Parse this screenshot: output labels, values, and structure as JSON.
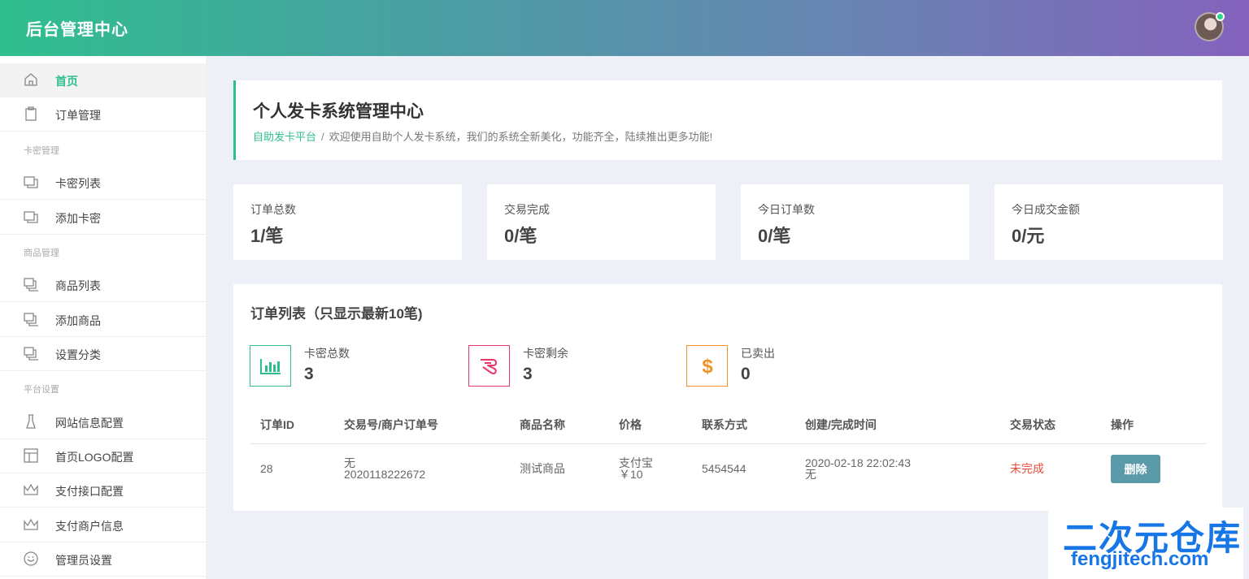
{
  "header": {
    "title": "后台管理中心"
  },
  "sidebar": {
    "items": [
      {
        "label": "首页",
        "icon": "home-icon",
        "active": true
      },
      {
        "label": "订单管理",
        "icon": "clipboard-icon"
      },
      {
        "label": "卡密列表",
        "icon": "copy-icon"
      },
      {
        "label": "添加卡密",
        "icon": "copy-icon"
      },
      {
        "label": "商品列表",
        "icon": "stack-icon"
      },
      {
        "label": "添加商品",
        "icon": "stack-icon"
      },
      {
        "label": "设置分类",
        "icon": "stack-icon"
      },
      {
        "label": "网站信息配置",
        "icon": "flask-icon"
      },
      {
        "label": "首页LOGO配置",
        "icon": "layout-icon"
      },
      {
        "label": "支付接口配置",
        "icon": "crown-icon"
      },
      {
        "label": "支付商户信息",
        "icon": "crown-icon"
      },
      {
        "label": "管理员设置",
        "icon": "smile-icon"
      }
    ],
    "sections": [
      "卡密管理",
      "商品管理",
      "平台设置"
    ]
  },
  "hero": {
    "title": "个人发卡系统管理中心",
    "breadcrumb": "自助发卡平台",
    "separator": "/",
    "message": "欢迎使用自助个人发卡系统，我们的系统全新美化，功能齐全，陆续推出更多功能!"
  },
  "stats": [
    {
      "label": "订单总数",
      "value": "1/笔"
    },
    {
      "label": "交易完成",
      "value": "0/笔"
    },
    {
      "label": "今日订单数",
      "value": "0/笔"
    },
    {
      "label": "今日成交金额",
      "value": "0/元"
    }
  ],
  "orders": {
    "title": "订单列表（只显示最新10笔)",
    "kpis": [
      {
        "label": "卡密总数",
        "value": "3",
        "icon": "bar-chart-icon",
        "color": "#2fbf8e"
      },
      {
        "label": "卡密剩余",
        "value": "3",
        "icon": "hand-icon",
        "color": "#e8356b"
      },
      {
        "label": "已卖出",
        "value": "0",
        "icon": "dollar-icon",
        "color": "#f0912a"
      }
    ],
    "columns": [
      "订单ID",
      "交易号/商户订单号",
      "商品名称",
      "价格",
      "联系方式",
      "创建/完成时间",
      "交易状态",
      "操作"
    ],
    "rows": [
      {
        "id": "28",
        "trade_no": "无",
        "merchant_no": "2020118222672",
        "product": "测试商品",
        "pay_method": "支付宝",
        "price": "￥10",
        "contact": "5454544",
        "created": "2020-02-18 22:02:43",
        "finished": "无",
        "status": "未完成",
        "action": "删除"
      }
    ]
  },
  "watermark": {
    "main": "二次元仓库",
    "sub": "fengjitech.com"
  }
}
